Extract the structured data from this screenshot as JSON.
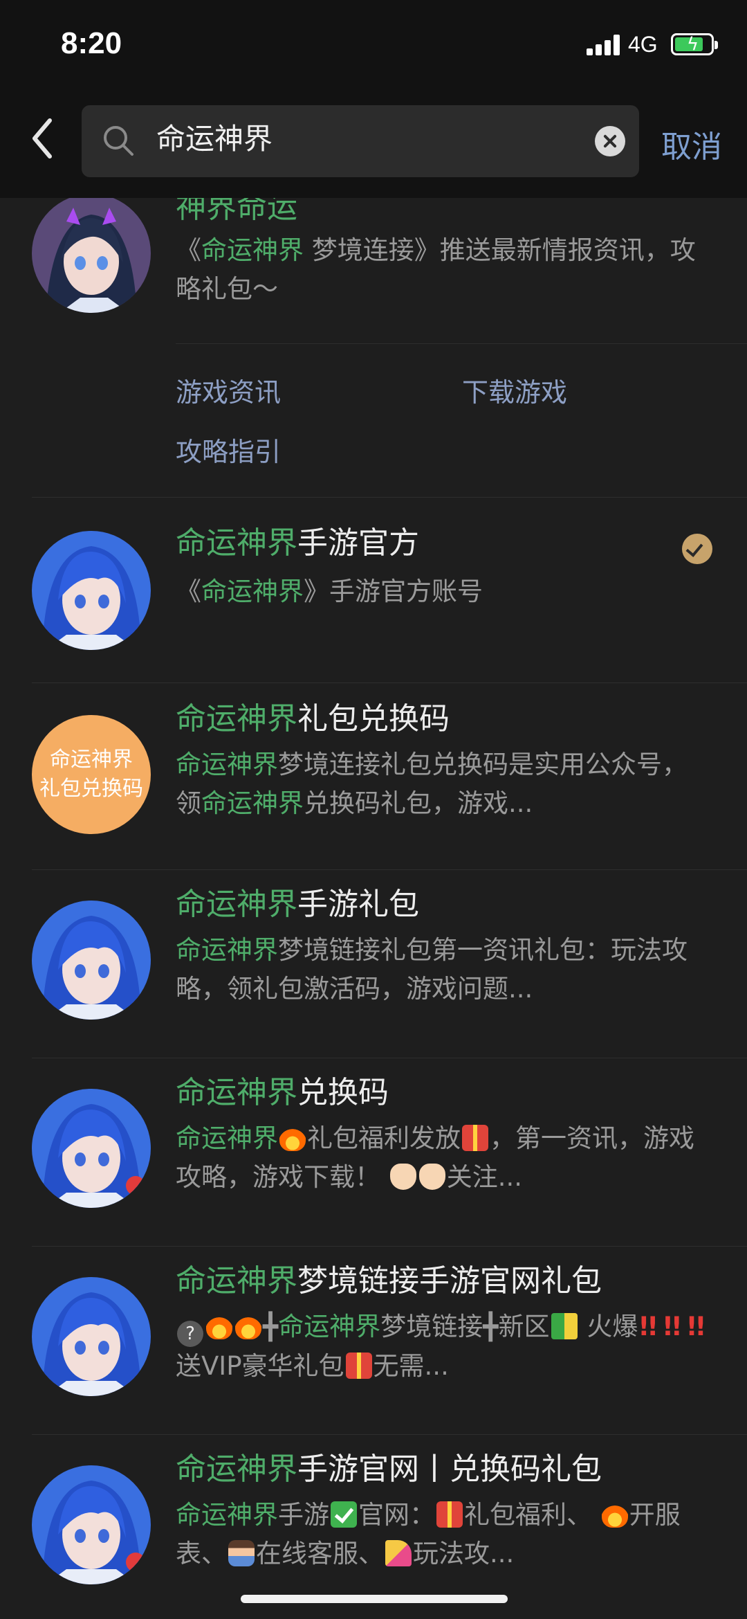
{
  "status_bar": {
    "time": "8:20",
    "network": "4G"
  },
  "search": {
    "query": "命运神界",
    "cancel_label": "取消"
  },
  "results": [
    {
      "title": "神界命运",
      "desc_parts": [
        "《",
        "命运神界",
        " 梦境连接》推送最新情报资讯，攻略礼包～"
      ],
      "menu": [
        "游戏资讯",
        "下载游戏",
        "攻略指引"
      ]
    },
    {
      "title_hl": "命运神界",
      "title_rest": "手游官方",
      "desc_pre": "《",
      "desc_hl": "命运神界",
      "desc_post": "》手游官方账号"
    },
    {
      "avatar_text_1": "命运神界",
      "avatar_text_2": "礼包兑换码",
      "title_hl": "命运神界",
      "title_rest": "礼包兑换码",
      "desc_hl1": "命运神界",
      "desc_mid": "梦境连接礼包兑换码是实用公众号，领",
      "desc_hl2": "命运神界",
      "desc_post": "兑换码礼包，游戏..."
    },
    {
      "title_hl": "命运神界",
      "title_rest": "手游礼包",
      "desc_hl": "命运神界",
      "desc_post": "梦境链接礼包第一资讯礼包：玩法攻略，领礼包激活码，游戏问题..."
    },
    {
      "title_hl": "命运神界",
      "title_rest": "兑换码",
      "desc_hl": "命运神界",
      "desc_a": "礼包福利发放",
      "desc_b": "，第一资讯，游戏攻略，游戏下载！",
      "desc_c": "关注..."
    },
    {
      "title_hl": "命运神界",
      "title_rest": "梦境链接手游官网礼包",
      "desc_a": "╋",
      "desc_hl": "命运神界",
      "desc_b": "梦境链接╋新区",
      "desc_c": "火爆",
      "desc_d": "送VIP豪华礼包",
      "desc_e": "无需..."
    },
    {
      "title_hl": "命运神界",
      "title_rest": "手游官网丨兑换码礼包",
      "desc_hl": "命运神界",
      "desc_a": "手游",
      "desc_b": "官网：",
      "desc_c": "礼包福利、",
      "desc_d": "开服表、",
      "desc_e": "在线客服、",
      "desc_f": "玩法攻..."
    }
  ],
  "icons": {
    "back": "chevron-left-icon",
    "search": "search-icon",
    "clear": "clear-icon",
    "verified": "verified-icon"
  }
}
